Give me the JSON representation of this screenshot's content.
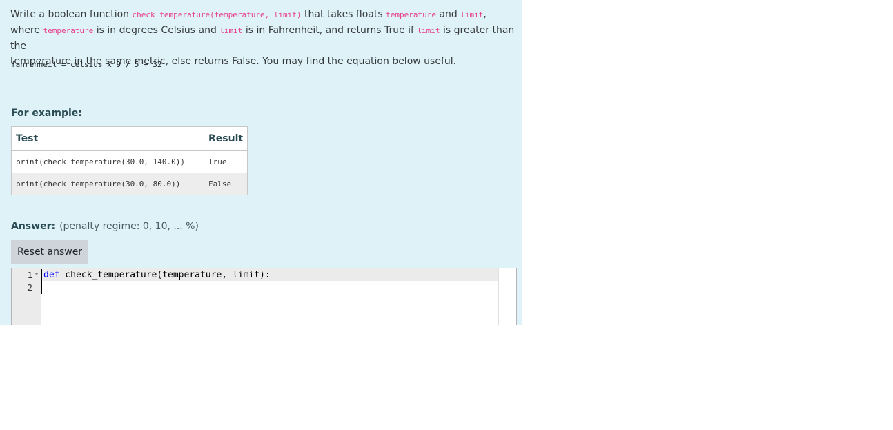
{
  "question": {
    "intro_1": "Write a boolean function ",
    "fn_signature": "check_temperature(temperature, limit)",
    "intro_2": " that takes floats ",
    "arg_temperature": "temperature",
    "intro_3": " and ",
    "arg_limit": "limit",
    "intro_4": ",",
    "intro_5": "where ",
    "arg_temperature_2": "temperature",
    "intro_6": " is in degrees Celsius and ",
    "arg_limit_2": "limit",
    "intro_7": " is in Fahrenheit, and returns True if ",
    "arg_limit_3": "limit",
    "intro_8": " is greater than the",
    "intro_9": "temperature in the same metric, else returns False. You may find the equation below useful.",
    "formula": "fahrenheit = celsius x 9 / 5 + 32"
  },
  "examples": {
    "heading": "For example:",
    "columns": [
      "Test",
      "Result"
    ],
    "rows": [
      {
        "test": "print(check_temperature(30.0, 140.0))",
        "result": "True"
      },
      {
        "test": "print(check_temperature(30.0, 80.0))",
        "result": "False"
      }
    ]
  },
  "answer": {
    "label": "Answer:",
    "penalty": "(penalty regime: 0, 10, ... %)",
    "reset_label": "Reset answer"
  },
  "editor": {
    "line_numbers": [
      "1",
      "2"
    ],
    "line1_keyword": "def",
    "line1_rest": " check_temperature(temperature, limit):",
    "line2": ""
  },
  "colors": {
    "panel_bg": "#def2f8",
    "code_pink": "#e83e8c",
    "keyword_blue": "#0000ff",
    "button_bg": "#ced4da"
  }
}
